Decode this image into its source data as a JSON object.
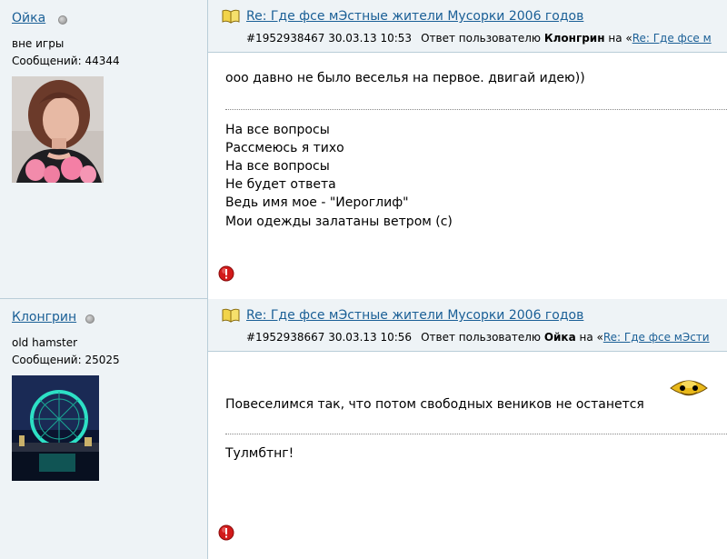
{
  "posts": [
    {
      "author": {
        "name": "Ойка",
        "status": "вне игры",
        "messages": "Сообщений: 44344"
      },
      "title": "Re: Где фсе мЭстные жители Мусорки 2006 годов",
      "meta": {
        "id_date": "#1952938467 30.03.13 10:53",
        "reply_label": "Ответ пользователю",
        "reply_user": "Клонгрин",
        "on_label": "на «",
        "reply_link": "Re: Где фсе м"
      },
      "body_lines": [
        "ооо давно не было веселья на первое. двигай идею))"
      ],
      "signature_lines": [
        "На все вопросы",
        "Рассмеюсь я тихо",
        "На все вопросы",
        "Не будет ответа",
        "Ведь имя мое - \"Иероглиф\"",
        "Мои одежды залатаны ветром (с)"
      ]
    },
    {
      "author": {
        "name": "Клонгрин",
        "status": "old hamster",
        "messages": "Сообщений: 25025"
      },
      "title": "Re: Где фсе мЭстные жители Мусорки 2006 годов",
      "meta": {
        "id_date": "#1952938667 30.03.13 10:56",
        "reply_label": "Ответ пользователю",
        "reply_user": "Ойка",
        "on_label": "на «",
        "reply_link": "Re: Где фсе мЭсти"
      },
      "body_lines": [
        "Повеселимся так, что потом свободных веников не останется"
      ],
      "signature_lines": [
        "Тулмбтнг!"
      ]
    }
  ],
  "colors": {
    "panel": "#eef3f6",
    "border": "#b9cdd8",
    "link": "#1a5f96",
    "warn": "#d21a1a"
  },
  "icons": {
    "title": "book-icon",
    "report": "warning-icon",
    "status": "offline-dot-icon",
    "emote": "gold-smiley-icon"
  }
}
